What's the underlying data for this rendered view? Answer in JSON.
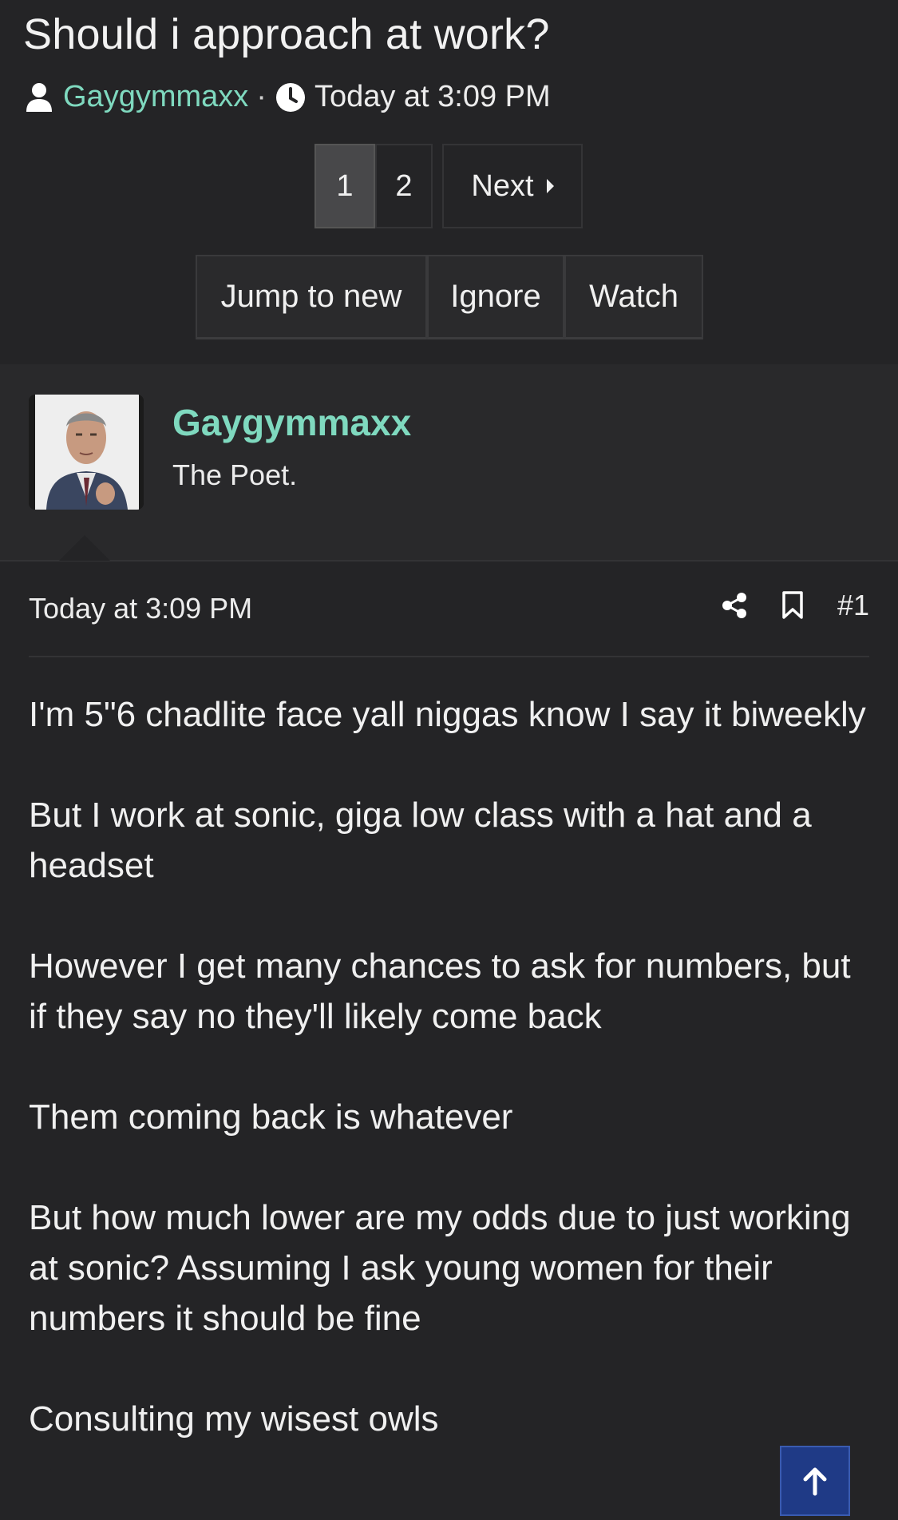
{
  "thread": {
    "title": "Should i approach at work?",
    "author": "Gaygymmaxx",
    "separator": "·",
    "time": "Today at 3:09 PM"
  },
  "pagination": {
    "pages": [
      "1",
      "2"
    ],
    "current": "1",
    "next_label": "Next"
  },
  "actions": {
    "jump_label": "Jump to new",
    "ignore_label": "Ignore",
    "watch_label": "Watch"
  },
  "post": {
    "user_name": "Gaygymmaxx",
    "user_title": "The Poet.",
    "date": "Today at 3:09 PM",
    "number": "#1",
    "paragraphs": [
      "I'm 5\"6 chadlite face yall niggas know I say it biweekly",
      "But I work at sonic, giga low class with a hat and a headset",
      "However I get many chances to ask for numbers, but if they say no they'll likely come back",
      "Them coming back is whatever",
      "But how much lower are my odds due to just working at sonic? Assuming I ask young women for their numbers it should be fine",
      "Consulting my wisest owls"
    ]
  },
  "icons": {
    "user": "user-icon",
    "clock": "clock-icon",
    "share": "share-icon",
    "bookmark": "bookmark-icon",
    "scroll_top": "arrow-up-icon"
  },
  "colors": {
    "background": "#242426",
    "accent": "#7fd9bf",
    "scroll_button": "#1f3a86"
  }
}
